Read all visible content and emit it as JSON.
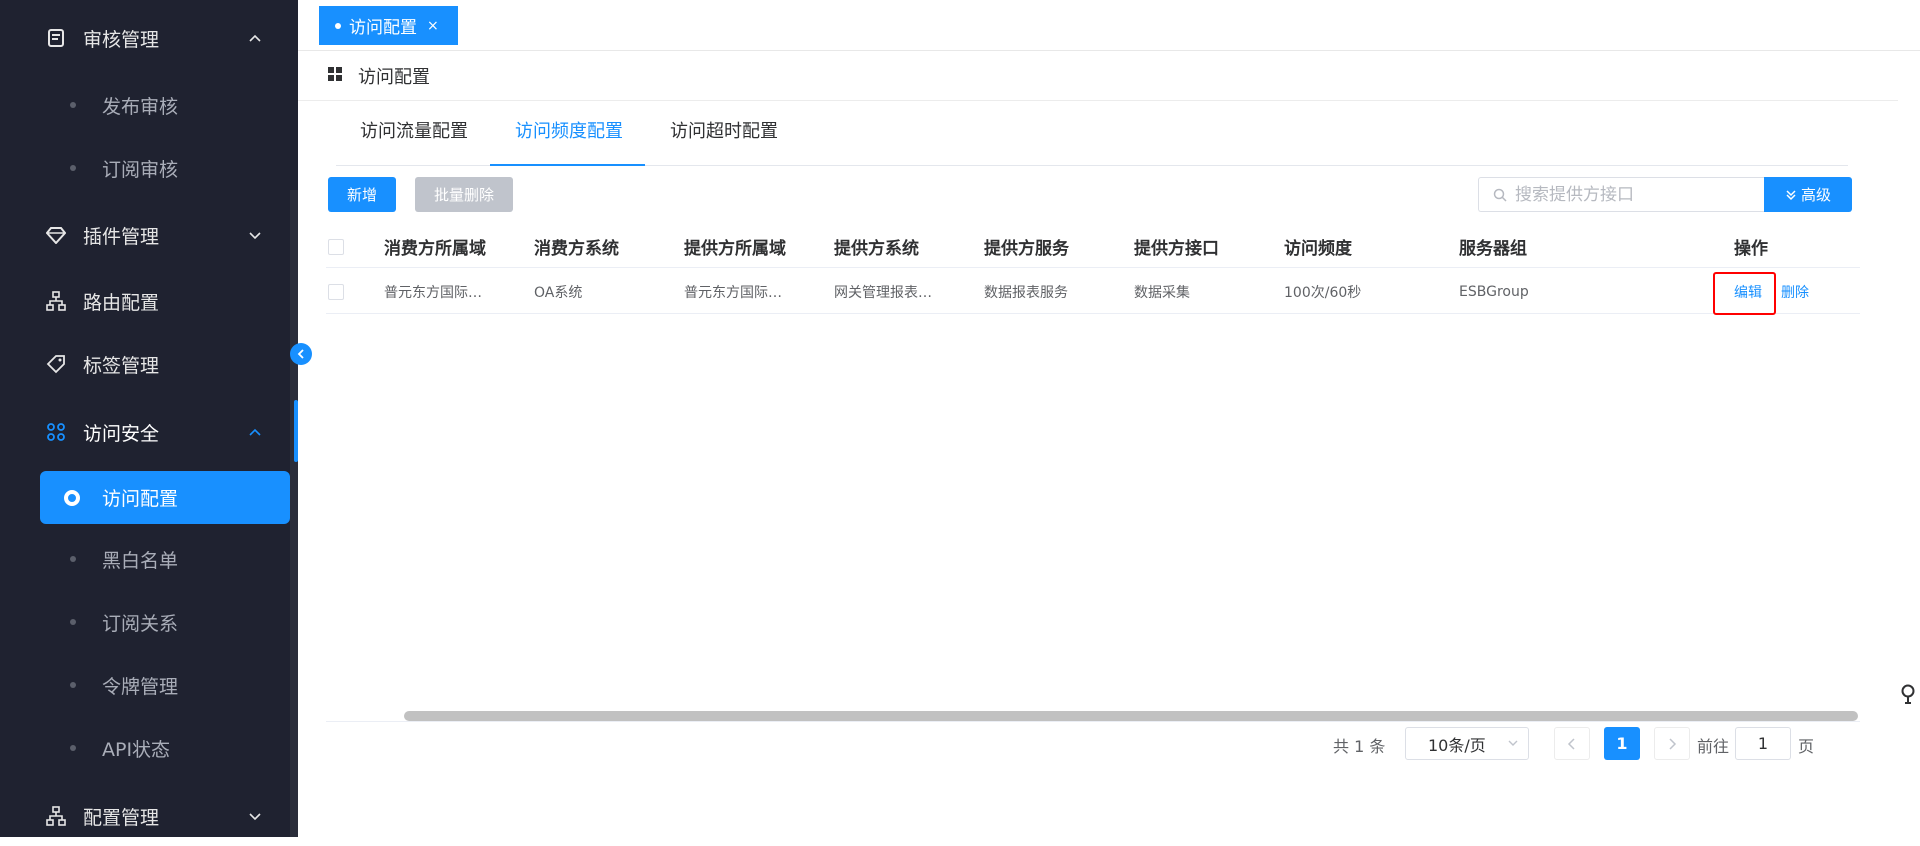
{
  "sidebar": {
    "items": [
      {
        "label": "审核管理"
      },
      {
        "label": "发布审核"
      },
      {
        "label": "订阅审核"
      },
      {
        "label": "插件管理"
      },
      {
        "label": "路由配置"
      },
      {
        "label": "标签管理"
      },
      {
        "label": "访问安全"
      },
      {
        "label": "访问配置"
      },
      {
        "label": "黑白名单"
      },
      {
        "label": "订阅关系"
      },
      {
        "label": "令牌管理"
      },
      {
        "label": "API状态"
      },
      {
        "label": "配置管理"
      }
    ]
  },
  "tagbar": {
    "active_tag": "访问配置",
    "close": "×"
  },
  "breadcrumb": {
    "title": "访问配置"
  },
  "tabs": [
    {
      "label": "访问流量配置"
    },
    {
      "label": "访问频度配置"
    },
    {
      "label": "访问超时配置"
    }
  ],
  "toolbar": {
    "add_label": "新增",
    "batch_delete_label": "批量删除",
    "search_placeholder": "搜索提供方接口",
    "advanced_label": "高级"
  },
  "table": {
    "headers": [
      "消费方所属域",
      "消费方系统",
      "提供方所属域",
      "提供方系统",
      "提供方服务",
      "提供方接口",
      "访问频度",
      "服务器组",
      "操作"
    ],
    "rows": [
      {
        "cells": [
          "普元东方国际…",
          "OA系统",
          "普元东方国际…",
          "网关管理报表…",
          "数据报表服务",
          "数据采集",
          "100次/60秒",
          "ESBGroup"
        ],
        "edit": "编辑",
        "delete": "删除"
      }
    ]
  },
  "pagination": {
    "total": "共 1 条",
    "page_size": "10条/页",
    "current_page": "1",
    "goto_prefix": "前往",
    "goto_value": "1",
    "goto_suffix": "页"
  },
  "colors": {
    "sidebar_bg": "#1f2230",
    "accent": "#1890ff",
    "highlight": "#ff0000",
    "disabled_button": "#c0c4cc"
  }
}
